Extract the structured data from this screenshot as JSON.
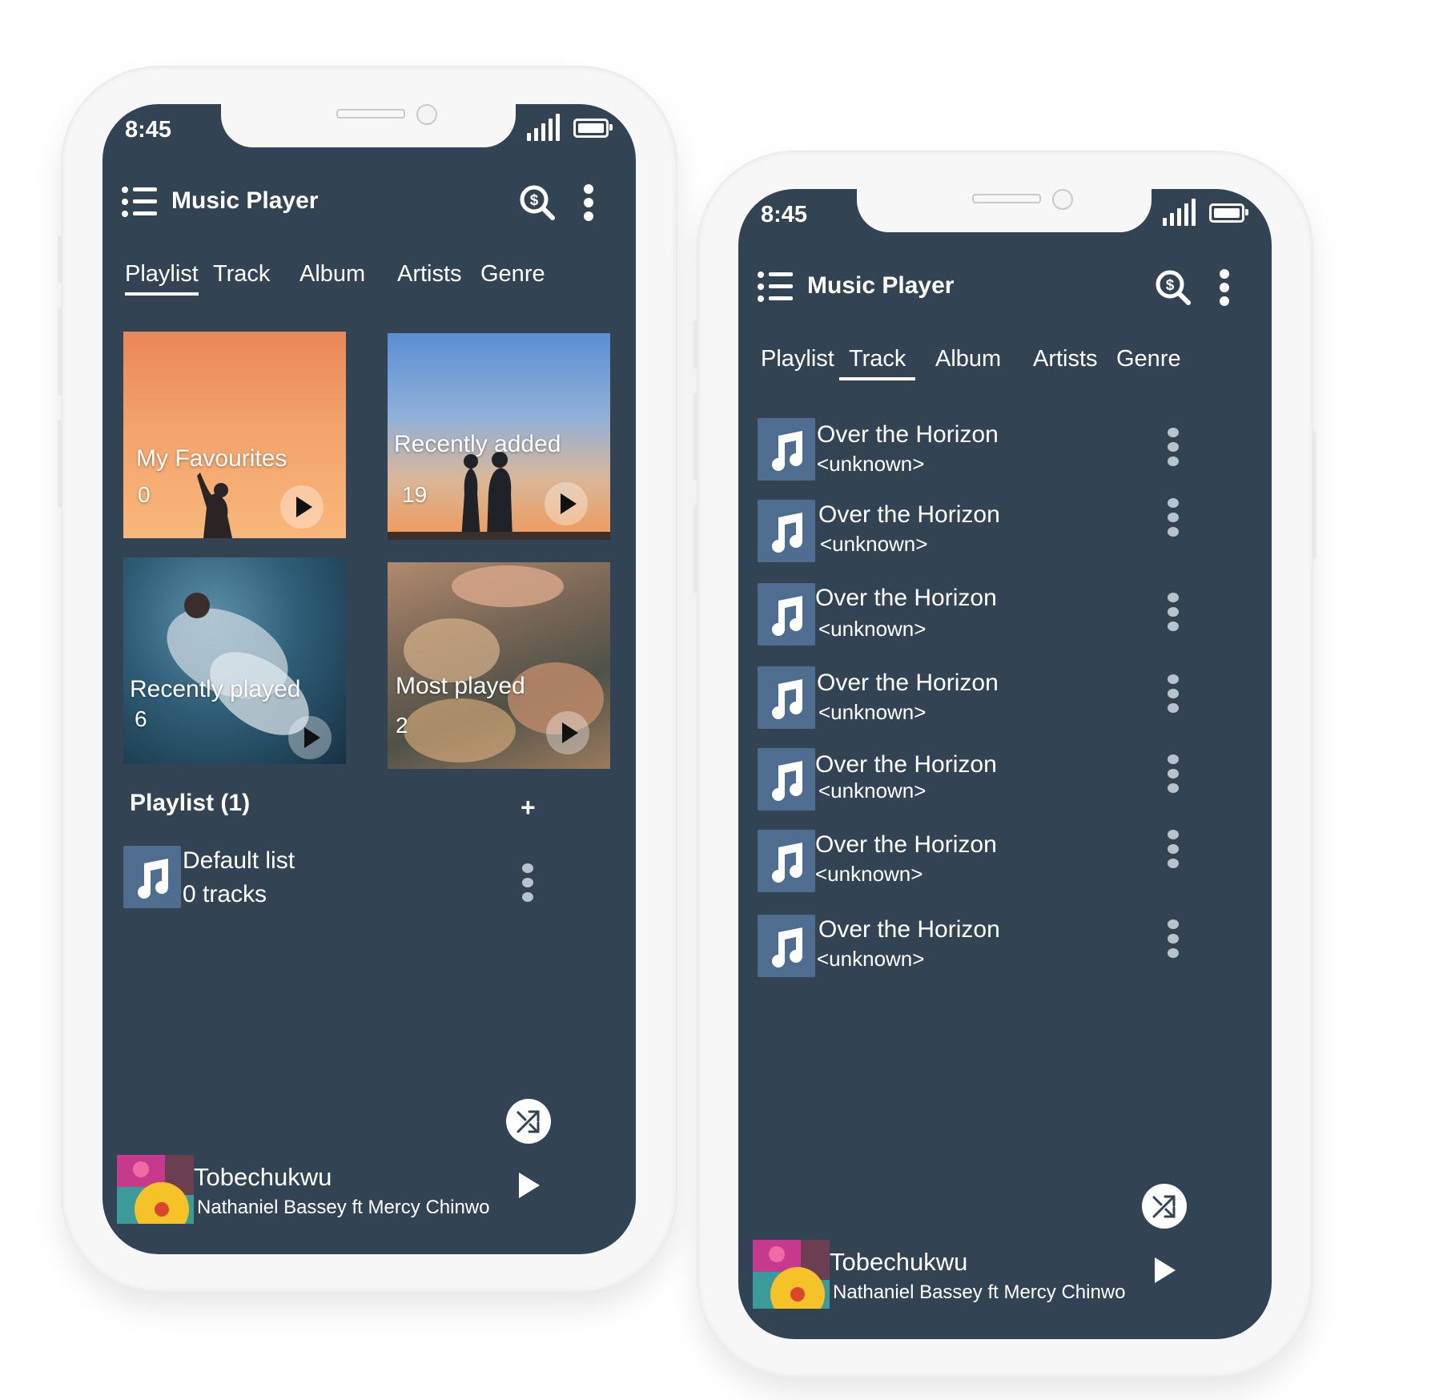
{
  "colors": {
    "screen_bg": "#324454",
    "thumb_bg": "#4f6d8f",
    "text": "#ffffff",
    "frame": "#f7f7f7"
  },
  "status_bar": {
    "time": "8:45"
  },
  "app": {
    "title": "Music Player"
  },
  "tabs": [
    "Playlist",
    "Track",
    "Album",
    "Artists",
    "Genre"
  ],
  "phone_left": {
    "active_tab": "Playlist",
    "tiles": [
      {
        "label": "My Favourites",
        "count": "0"
      },
      {
        "label": "Recently added",
        "count": "19"
      },
      {
        "label": "Recently played",
        "count": "6"
      },
      {
        "label": "Most played",
        "count": "2"
      }
    ],
    "section_title": "Playlist (1)",
    "add_icon": "+",
    "playlists": [
      {
        "title": "Default list",
        "subtitle": "0 tracks"
      }
    ]
  },
  "phone_right": {
    "active_tab": "Track",
    "tracks": [
      {
        "title": "Over the Horizon",
        "artist": "<unknown>"
      },
      {
        "title": "Over the Horizon",
        "artist": "<unknown>"
      },
      {
        "title": "Over the Horizon",
        "artist": "<unknown>"
      },
      {
        "title": "Over the Horizon",
        "artist": "<unknown>"
      },
      {
        "title": "Over the Horizon",
        "artist": "<unknown>"
      },
      {
        "title": "Over the Horizon",
        "artist": "<unknown>"
      },
      {
        "title": "Over the Horizon",
        "artist": "<unknown>"
      }
    ]
  },
  "now_playing": {
    "title": "Tobechukwu",
    "artist": "Nathaniel Bassey ft Mercy Chinwo"
  },
  "icons": {
    "menu": "list-menu-icon",
    "search": "search-dollar-icon",
    "more": "more-vertical-icon",
    "shuffle": "shuffle-icon",
    "play": "play-icon",
    "music_note": "music-note-icon"
  }
}
